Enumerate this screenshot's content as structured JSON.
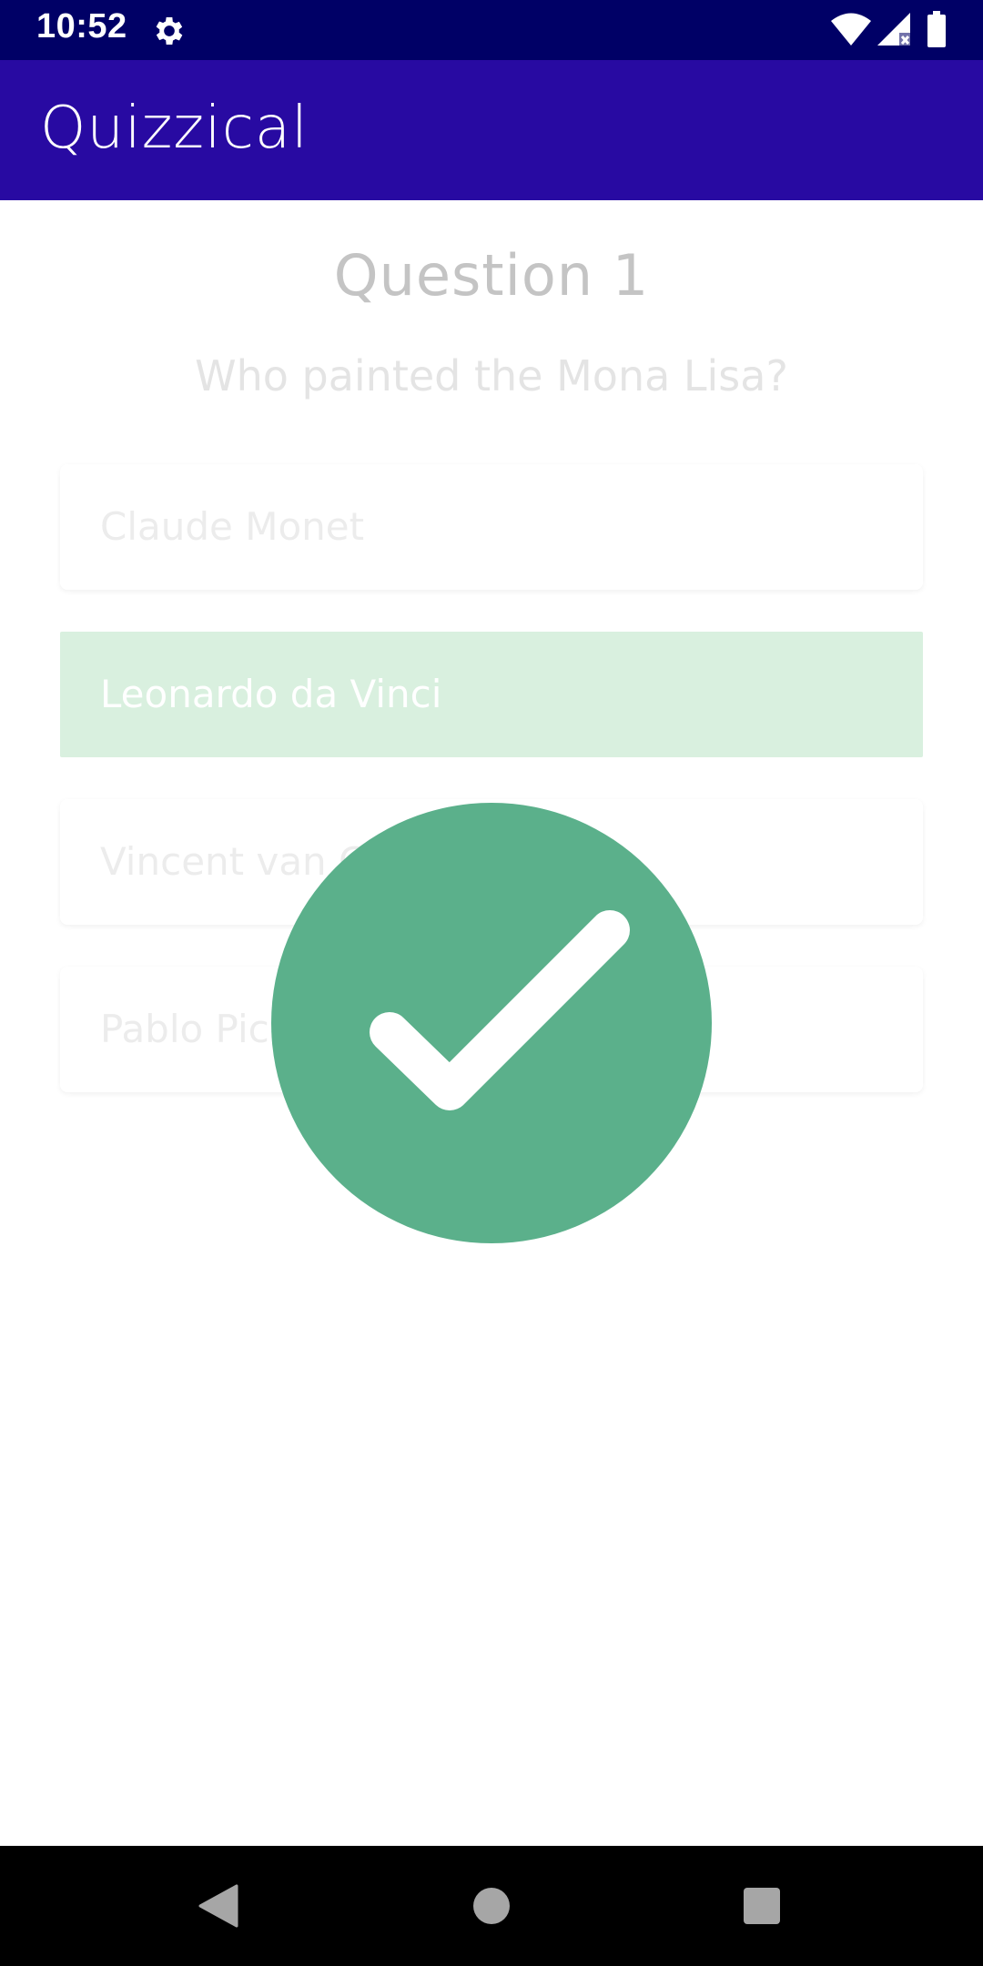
{
  "status_bar": {
    "time": "10:52",
    "icons": [
      "gear-icon",
      "wifi-icon",
      "cell-signal-icon",
      "battery-icon"
    ]
  },
  "app_bar": {
    "title": "Quizzical"
  },
  "quiz": {
    "question_number": "Question 1",
    "question_text": "Who painted the Mona Lisa?",
    "answers": [
      {
        "label": "Claude Monet",
        "state": "dimmed"
      },
      {
        "label": "Leonardo da Vinci",
        "state": "correct"
      },
      {
        "label": "Vincent van Gogh",
        "state": "dimmed"
      },
      {
        "label": "Pablo Picasso",
        "state": "dimmed"
      }
    ]
  },
  "result": {
    "icon": "checkmark-icon",
    "state": "correct"
  },
  "nav_bar": {
    "icons": [
      "back-icon",
      "home-icon",
      "recents-icon"
    ]
  },
  "colors": {
    "status_bar": "#000066",
    "app_bar": "#280aa2",
    "correct_answer_bg": "#d9f0df",
    "result_circle": "#5bb08b"
  }
}
